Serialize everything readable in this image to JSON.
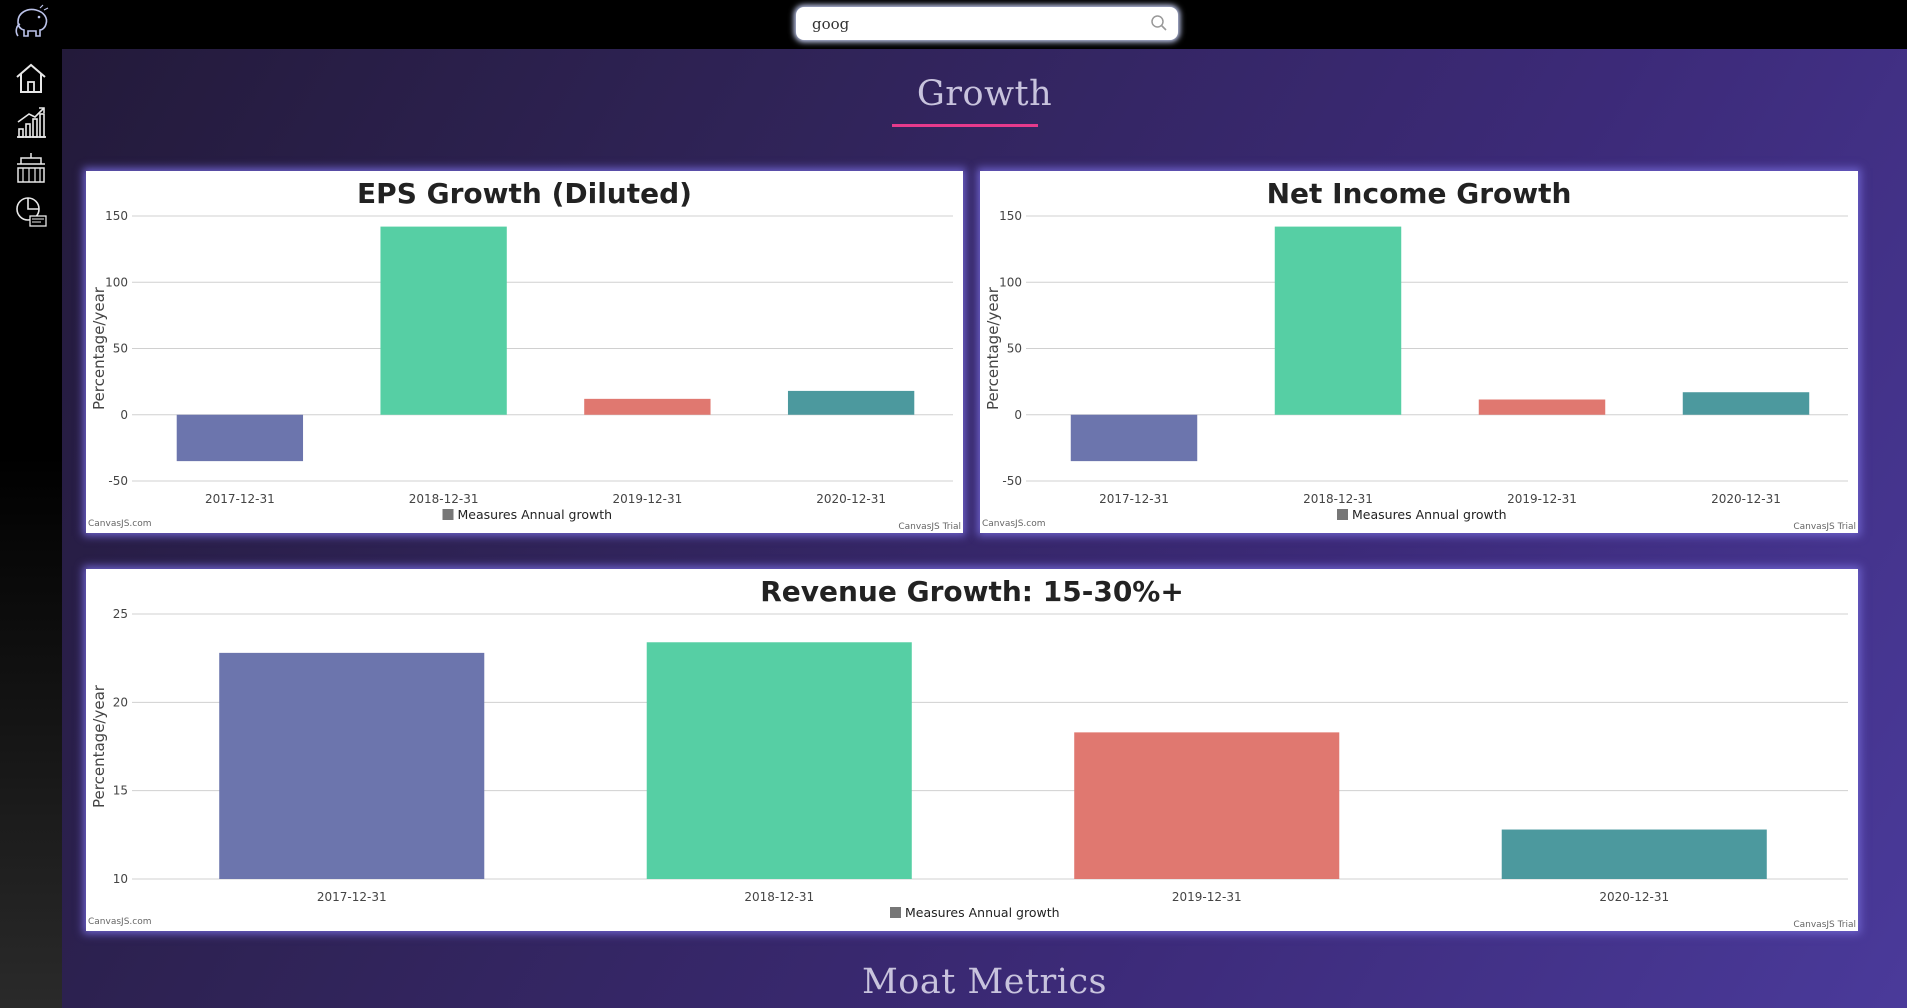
{
  "search": {
    "value": "goog",
    "icon": "search-icon"
  },
  "sidebar": {
    "logo_icon": "elephant-logo-icon",
    "items": [
      {
        "icon": "home-icon",
        "name": "home"
      },
      {
        "icon": "growth-chart-icon",
        "name": "growth"
      },
      {
        "icon": "building-icon",
        "name": "moat"
      },
      {
        "icon": "pie-debt-icon",
        "name": "debt"
      }
    ]
  },
  "sections": {
    "growth_title": "Growth",
    "moat_title": "Moat Metrics"
  },
  "colors": {
    "bar_1": "#6c75ad",
    "bar_2": "#56cfa4",
    "bar_3": "#e07870",
    "bar_4": "#4c999e",
    "accent": "#e63a8c"
  },
  "chart_data": [
    {
      "id": "eps",
      "type": "bar",
      "title": "EPS Growth (Diluted)",
      "ylabel": "Percentage/year",
      "categories": [
        "2017-12-31",
        "2018-12-31",
        "2019-12-31",
        "2020-12-31"
      ],
      "values": [
        -35,
        142,
        12,
        18
      ],
      "ylim": [
        -50,
        150
      ],
      "yticks": [
        -50,
        0,
        50,
        100,
        150
      ],
      "legend": "Measures Annual growth",
      "credit_left": "CanvasJS.com",
      "credit_right": "CanvasJS Trial"
    },
    {
      "id": "net_income",
      "type": "bar",
      "title": "Net Income Growth",
      "ylabel": "Percentage/year",
      "categories": [
        "2017-12-31",
        "2018-12-31",
        "2019-12-31",
        "2020-12-31"
      ],
      "values": [
        -35,
        142,
        11.5,
        17
      ],
      "ylim": [
        -50,
        150
      ],
      "yticks": [
        -50,
        0,
        50,
        100,
        150
      ],
      "legend": "Measures Annual growth",
      "credit_left": "CanvasJS.com",
      "credit_right": "CanvasJS Trial"
    },
    {
      "id": "revenue",
      "type": "bar",
      "title": "Revenue Growth: 15-30%+",
      "ylabel": "Percentage/year",
      "categories": [
        "2017-12-31",
        "2018-12-31",
        "2019-12-31",
        "2020-12-31"
      ],
      "values": [
        22.8,
        23.4,
        18.3,
        12.8
      ],
      "ylim": [
        10,
        25
      ],
      "yticks": [
        10,
        15,
        20,
        25
      ],
      "legend": "Measures Annual growth",
      "credit_left": "CanvasJS.com",
      "credit_right": "CanvasJS Trial"
    }
  ]
}
